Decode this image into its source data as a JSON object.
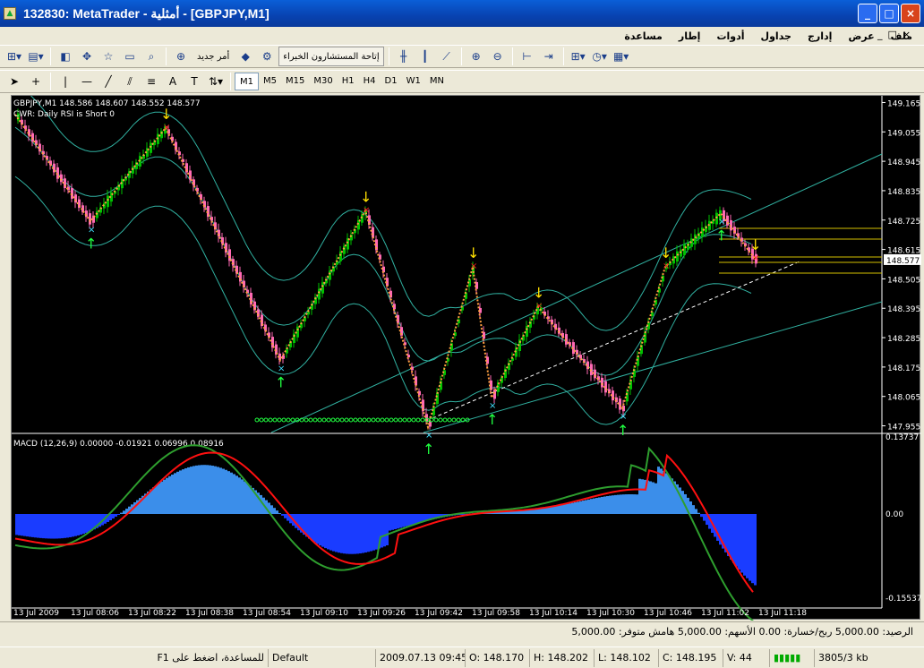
{
  "window": {
    "title": "132830: MetaTrader - أمثلية - [GBPJPY,M1]",
    "minimize": "_",
    "maximize": "□",
    "close": "×"
  },
  "menu": [
    "ملف",
    "عرض",
    "إدارج",
    "جداول",
    "أدوات",
    "إطار",
    "مساعدة"
  ],
  "doc_buttons": [
    "_",
    "□",
    "×"
  ],
  "toolbar1": {
    "new_order": "أمر جديد",
    "expert_advisors": "إتاحة المستشارون الخبراء"
  },
  "timeframes": [
    "M1",
    "M5",
    "M15",
    "M30",
    "H1",
    "H4",
    "D1",
    "W1",
    "MN"
  ],
  "active_timeframe": "M1",
  "chart": {
    "info_line": "GBPJPY,M1  148.586 148.607 148.552 148.577",
    "indicator_line": "CWR: Daily RSI is Short 0",
    "price_ticks": [
      "149.165",
      "149.055",
      "148.945",
      "148.835",
      "148.725",
      "148.615",
      "148.505",
      "148.395",
      "148.285",
      "148.175",
      "148.065",
      "147.955"
    ],
    "current_price": "148.577",
    "time_labels": [
      "13 Jul 2009",
      "13 Jul 08:06",
      "13 Jul 08:22",
      "13 Jul 08:38",
      "13 Jul 08:54",
      "13 Jul 09:10",
      "13 Jul 09:26",
      "13 Jul 09:42",
      "13 Jul 09:58",
      "13 Jul 10:14",
      "13 Jul 10:30",
      "13 Jul 10:46",
      "13 Jul 11:02",
      "13 Jul 11:18"
    ],
    "macd_label": "MACD (12,26,9) 0.00000 -0.01921 0.06996 0.08916",
    "macd_ticks": [
      "0.13737",
      "0.00",
      "-0.15537"
    ],
    "colors": {
      "bull": "#00c000",
      "bear": "#ff69b4",
      "bands": "#30b0a0",
      "zigzag": "#ffa040",
      "macd_main": "#2e9e2e",
      "macd_signal": "#ff1010",
      "histo_pos": "#3b8eea",
      "histo_neg": "#1a3cff"
    }
  },
  "chart_data": {
    "type": "line",
    "title": "GBPJPY,M1",
    "x": [
      "08:00",
      "08:14",
      "08:22",
      "08:52",
      "09:26",
      "09:42",
      "09:52",
      "10:02",
      "10:14",
      "10:34",
      "10:52",
      "11:00",
      "11:10"
    ],
    "series": [
      {
        "values": [
          149.12,
          148.72,
          149.07,
          148.2,
          148.76,
          147.95,
          148.55,
          148.06,
          148.4,
          148.02,
          148.55,
          148.75,
          148.58
        ]
      }
    ],
    "ylim": [
      147.93,
      149.19
    ]
  },
  "status": {
    "balance_text": "الرصيد: 5,000.00  ربح/خسارة: 0.00  الأسهم: 5,000.00  هامش متوفر: 5,000.00",
    "help": "للمساعدة، اضغط على F1",
    "profile": "Default",
    "datetime": "2009.07.13 09:45",
    "open": "O: 148.170",
    "high": "H: 148.202",
    "low": "L: 148.102",
    "close": "C: 148.195",
    "volume": "V: 44",
    "traffic": "3805/3 kb"
  }
}
